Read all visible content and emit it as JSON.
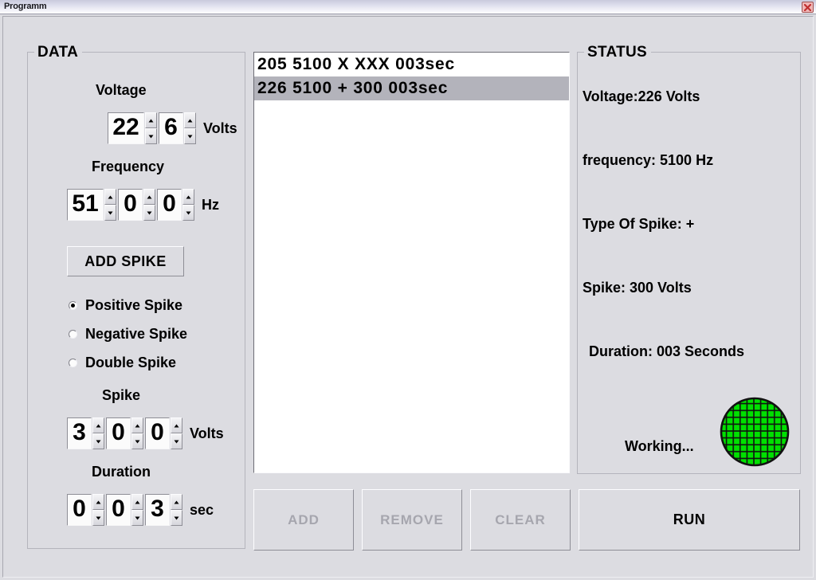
{
  "window": {
    "title": "Programm",
    "close_icon": "close-icon"
  },
  "data_panel": {
    "title": "DATA",
    "voltage": {
      "label": "Voltage",
      "digits": [
        "22",
        "6"
      ],
      "unit": "Volts"
    },
    "frequency": {
      "label": "Frequency",
      "digits": [
        "51",
        "0",
        "0"
      ],
      "unit": "Hz"
    },
    "add_spike_button": "ADD SPIKE",
    "spike_type_options": [
      {
        "label": "Positive Spike",
        "selected": true
      },
      {
        "label": "Negative Spike",
        "selected": false
      },
      {
        "label": "Double Spike",
        "selected": false
      }
    ],
    "spike": {
      "label": "Spike",
      "digits": [
        "3",
        "0",
        "0"
      ],
      "unit": "Volts"
    },
    "duration": {
      "label": "Duration",
      "digits": [
        "0",
        "0",
        "3"
      ],
      "unit": "sec"
    }
  },
  "list": {
    "items": [
      {
        "text": "205  5100  X  XXX  003sec",
        "selected": false
      },
      {
        "text": "226  5100  +  300  003sec",
        "selected": true
      }
    ]
  },
  "status_panel": {
    "title": "STATUS",
    "voltage": "Voltage:226  Volts",
    "frequency": "frequency:   5100  Hz",
    "type_of_spike": "Type Of Spike: +",
    "spike": "Spike:   300  Volts",
    "duration": "Duration:  003  Seconds",
    "working": "Working...",
    "led_color": "#00e000"
  },
  "actions": {
    "add": "ADD",
    "remove": "REMOVE",
    "clear": "CLEAR",
    "run": "RUN"
  }
}
